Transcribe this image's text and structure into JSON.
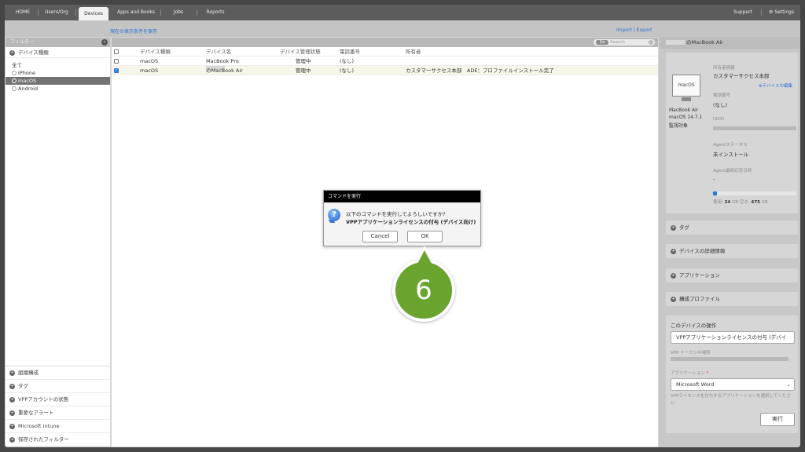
{
  "nav": {
    "items": [
      "HOME",
      "Users/Org",
      "Devices",
      "Apps and Books",
      "Jobs",
      "Reports"
    ],
    "support": "Support",
    "settings": "Settings"
  },
  "links": {
    "save_filter": "現在の表示条件を保存",
    "import": "Import",
    "export": "Export",
    "sep": "|"
  },
  "filter": {
    "header": "フィルター",
    "device_type_label": "デバイス種類",
    "options": [
      "全て",
      "iPhone",
      "macOS",
      "Android"
    ],
    "selected": "macOS",
    "bottom_sections": [
      "組織構成",
      "タグ",
      "VPPアカウントの状態",
      "重要なアラート",
      "Microsoft Intune",
      "保存されたフィルター"
    ]
  },
  "table": {
    "search_placeholder": "Search",
    "columns": [
      "デバイス種類",
      "デバイス名",
      "デバイス管理状態",
      "電話番号",
      "所有者"
    ],
    "rows": [
      {
        "type": "macOS",
        "name": "MacBook Pro",
        "status": "管理中",
        "phone": "(なし)",
        "owner": "",
        "checked": false
      },
      {
        "type": "macOS",
        "name": "のMacBook Air",
        "status": "管理中",
        "phone": "(なし)",
        "owner": "カスタマーサクセス本部　ADE：プロファイルインストール完了",
        "checked": true
      }
    ]
  },
  "detail": {
    "title": "のMacBook Air",
    "monitor_label": "macOS",
    "model": "MacBook Air",
    "os": "macOS 14.7.1",
    "supervised": "監視対象",
    "owner_label": "所有者情報",
    "owner_value": "カスタマーサクセス本部",
    "edit_link": "デバイスの編集",
    "phone_label": "電話番号",
    "phone_value": "(なし)",
    "udid_label": "UDID",
    "agent_status_label": "Agentステータス",
    "agent_status_value": "未インストール",
    "agent_last_label": "Agent最終応答日時",
    "agent_last_value": "-",
    "storage_used_label": "使用:",
    "storage_used": "24",
    "storage_unit": "GB",
    "storage_free_label": "空き:",
    "storage_free": "475",
    "storage_used_fraction": 0.048,
    "sections": [
      "タグ",
      "デバイスの詳細情報",
      "アプリケーション",
      "構成プロファイル"
    ],
    "ops_title": "このデバイスの操作",
    "op_selected": "VPPアプリケーションライセンスの付与 (デバイ",
    "vpp_token_label": "VPP トークンの場所",
    "app_label": "アプリケーション",
    "required_mark": "*",
    "app_selected": "Microsoft Word",
    "app_hint": "VPPライセンスを付与するアプリケーションを選択してください",
    "run_button": "実行"
  },
  "dialog": {
    "title": "コマンドを実行",
    "message": "以下のコマンドを実行してよろしいですか?",
    "command": "VPPアプリケーションライセンスの付与 (デバイス向け)",
    "cancel": "Cancel",
    "ok": "OK"
  },
  "callout": {
    "number": "6",
    "color": "#6aa42e"
  }
}
